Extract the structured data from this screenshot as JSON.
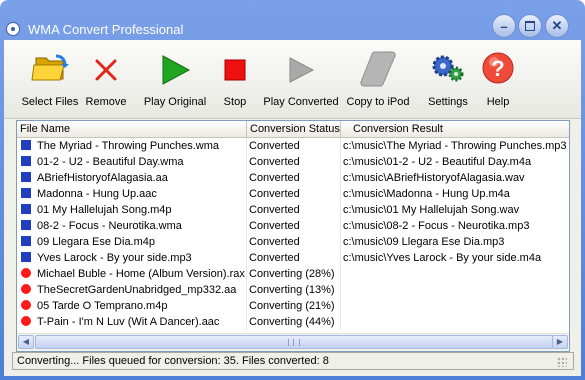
{
  "window": {
    "title": "WMA Convert Professional"
  },
  "toolbar": {
    "items": [
      {
        "label": "Select Files",
        "icon": "folder-open-icon"
      },
      {
        "label": "Remove",
        "icon": "red-x-icon"
      },
      {
        "label": "Play Original",
        "icon": "green-play-icon"
      },
      {
        "label": "Stop",
        "icon": "red-stop-icon"
      },
      {
        "label": "Play Converted",
        "icon": "gray-play-icon"
      },
      {
        "label": "Copy to iPod",
        "icon": "ipod-icon"
      },
      {
        "label": "Settings",
        "icon": "gears-icon"
      },
      {
        "label": "Help",
        "icon": "help-icon"
      }
    ]
  },
  "list": {
    "columns": [
      "File Name",
      "Conversion Status",
      "Conversion Result"
    ],
    "rows": [
      {
        "name": "The Myriad - Throwing Punches.wma",
        "status": "Converted",
        "result": "c:\\music\\The Myriad - Throwing Punches.mp3",
        "state": "done"
      },
      {
        "name": "01-2 - U2 - Beautiful Day.wma",
        "status": "Converted",
        "result": "c:\\music\\01-2 - U2 - Beautiful Day.m4a",
        "state": "done"
      },
      {
        "name": "ABriefHistoryofAlagasia.aa",
        "status": "Converted",
        "result": "c:\\music\\ABriefHistoryofAlagasia.wav",
        "state": "done"
      },
      {
        "name": "Madonna - Hung Up.aac",
        "status": "Converted",
        "result": "c:\\music\\Madonna - Hung Up.m4a",
        "state": "done"
      },
      {
        "name": "01 My Hallelujah Song.m4p",
        "status": "Converted",
        "result": "c:\\music\\01 My Hallelujah Song.wav",
        "state": "done"
      },
      {
        "name": "08-2 - Focus - Neurotika.wma",
        "status": "Converted",
        "result": "c:\\music\\08-2 - Focus - Neurotika.mp3",
        "state": "done"
      },
      {
        "name": "09 Llegara Ese Dia.m4p",
        "status": "Converted",
        "result": "c:\\music\\09 Llegara Ese Dia.mp3",
        "state": "done"
      },
      {
        "name": "Yves Larock - By your side.mp3",
        "status": "Converted",
        "result": "c:\\music\\Yves Larock - By your side.m4a",
        "state": "done"
      },
      {
        "name": "Michael Buble - Home (Album Version).rax",
        "status": "Converting (28%)",
        "result": "",
        "state": "busy"
      },
      {
        "name": "TheSecretGardenUnabridged_mp332.aa",
        "status": "Converting (13%)",
        "result": "",
        "state": "busy"
      },
      {
        "name": "05 Tarde O Temprano.m4p",
        "status": "Converting (21%)",
        "result": "",
        "state": "busy"
      },
      {
        "name": "T-Pain - I'm N Luv (Wit A Dancer).aac",
        "status": "Converting (44%)",
        "result": "",
        "state": "busy"
      }
    ]
  },
  "status_bar": {
    "text": "Converting... Files queued for conversion: 35. Files converted: 8"
  },
  "colors": {
    "converted_marker": "#1f3fbf",
    "converting_marker": "#ff1a1a",
    "title_bar": "#4f7fd6"
  }
}
